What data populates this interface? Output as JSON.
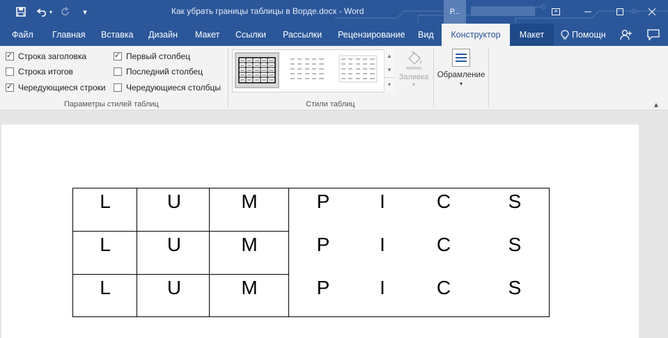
{
  "window": {
    "title": "Как убрать границы таблицы в Ворде.docx - Word",
    "account_initial": "Р..."
  },
  "tabs": {
    "file": "Файл",
    "home": "Главная",
    "insert": "Вставка",
    "design": "Дизайн",
    "layout": "Макет",
    "references": "Ссылки",
    "mailings": "Рассылки",
    "review": "Рецензирование",
    "view": "Вид",
    "table_design": "Конструктор",
    "table_layout": "Макет",
    "tell_me": "Помощн"
  },
  "ribbon": {
    "style_options": {
      "header_row": {
        "label": "Строка заголовка",
        "checked": true
      },
      "total_row": {
        "label": "Строка итогов",
        "checked": false
      },
      "banded_rows": {
        "label": "Чередующиеся строки",
        "checked": true
      },
      "first_column": {
        "label": "Первый столбец",
        "checked": true
      },
      "last_column": {
        "label": "Последний столбец",
        "checked": false
      },
      "banded_columns": {
        "label": "Чередующиеся столбцы",
        "checked": false
      },
      "group_label": "Параметры стилей таблиц"
    },
    "table_styles": {
      "group_label": "Стили таблиц"
    },
    "shading_label": "Заливка",
    "borders_label": "Обрамление"
  },
  "table": {
    "rows": [
      [
        "L",
        "U",
        "M",
        "P",
        "I",
        "C",
        "S"
      ],
      [
        "L",
        "U",
        "M",
        "P",
        "I",
        "C",
        "S"
      ],
      [
        "L",
        "U",
        "M",
        "P",
        "I",
        "C",
        "S"
      ]
    ]
  },
  "colors": {
    "accent": "#2b579a",
    "ribbon_bg": "#f3f3f3"
  }
}
